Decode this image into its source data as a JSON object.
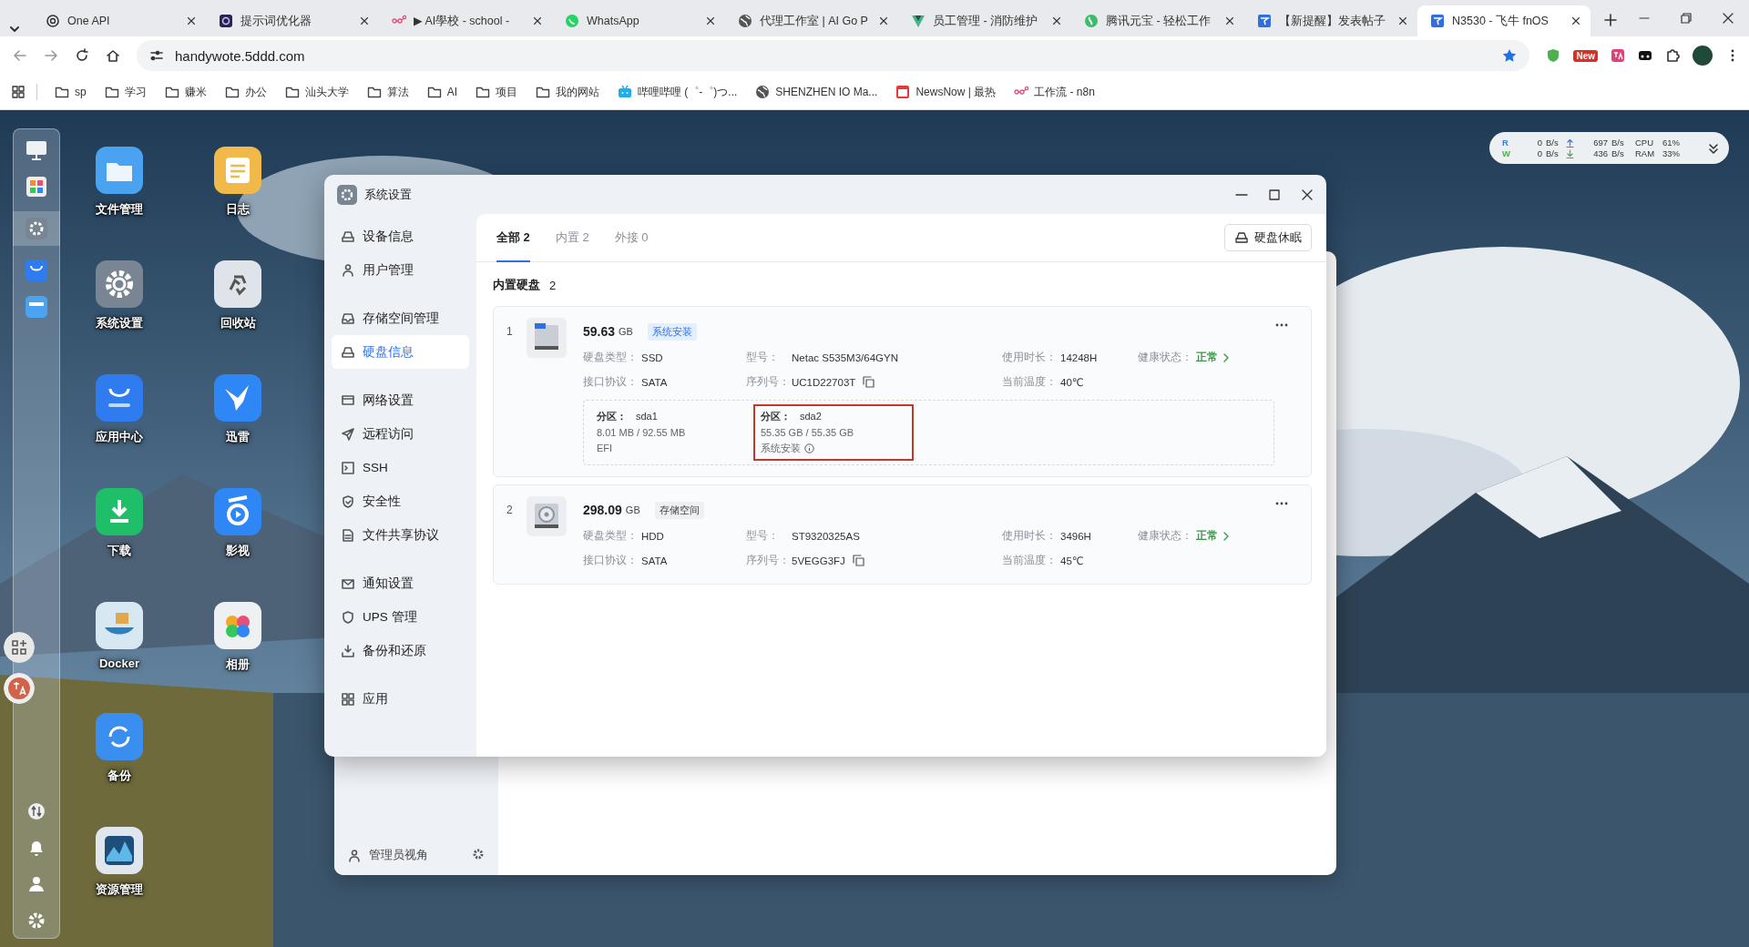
{
  "browser": {
    "tabs": [
      {
        "title": "One API",
        "selected": false
      },
      {
        "title": "提示词优化器",
        "selected": false
      },
      {
        "title": "▶ AI學校 - school -",
        "selected": false
      },
      {
        "title": "WhatsApp",
        "selected": false
      },
      {
        "title": "代理工作室 | AI Go P",
        "selected": false
      },
      {
        "title": "员工管理 - 消防维护",
        "selected": false
      },
      {
        "title": "腾讯元宝 - 轻松工作",
        "selected": false
      },
      {
        "title": "【新提醒】发表帖子",
        "selected": false
      },
      {
        "title": "N3530 - 飞牛 fnOS",
        "selected": true
      }
    ],
    "url": "handywote.5ddd.com",
    "extension_badge": "New",
    "bookmarks": [
      "sp",
      "学习",
      "赚米",
      "办公",
      "汕头大学",
      "算法",
      "AI",
      "项目",
      "我的网站",
      "哔哩哔哩 (゜-゜)つ...",
      "SHENZHEN IO Ma...",
      "NewsNow | 最热",
      "工作流 - n8n"
    ]
  },
  "desktop": {
    "columns": [
      [
        "文件管理",
        "系统设置",
        "应用中心",
        "下载",
        "Docker",
        "备份",
        "资源管理"
      ],
      [
        "日志",
        "回收站",
        "迅雷",
        "影视",
        "相册"
      ]
    ]
  },
  "monitor": {
    "rows": [
      {
        "label": "R",
        "disk": "0",
        "disk_unit": "B/s",
        "net": "697",
        "net_unit": "B/s",
        "metric": "CPU",
        "value": "61%"
      },
      {
        "label": "W",
        "disk": "0",
        "disk_unit": "B/s",
        "net": "436",
        "net_unit": "B/s",
        "metric": "RAM",
        "value": "33%"
      }
    ]
  },
  "back_window": {
    "footer": "管理员视角"
  },
  "settings": {
    "title": "系统设置",
    "sidebar": {
      "groups": [
        {
          "items": [
            {
              "label": "设备信息",
              "selected": false
            },
            {
              "label": "用户管理",
              "selected": false
            }
          ]
        },
        {
          "items": [
            {
              "label": "存储空间管理",
              "selected": false
            },
            {
              "label": "硬盘信息",
              "selected": true
            }
          ]
        },
        {
          "items": [
            {
              "label": "网络设置",
              "selected": false
            },
            {
              "label": "远程访问",
              "selected": false
            },
            {
              "label": "SSH",
              "selected": false
            },
            {
              "label": "安全性",
              "selected": false
            },
            {
              "label": "文件共享协议",
              "selected": false
            }
          ]
        },
        {
          "items": [
            {
              "label": "通知设置",
              "selected": false
            },
            {
              "label": "UPS 管理",
              "selected": false
            },
            {
              "label": "备份和还原",
              "selected": false
            }
          ]
        },
        {
          "items": [
            {
              "label": "应用",
              "selected": false
            }
          ]
        }
      ]
    },
    "tabs": [
      {
        "label": "全部 2",
        "selected": true
      },
      {
        "label": "内置 2",
        "selected": false
      },
      {
        "label": "外接 0",
        "selected": false
      }
    ],
    "sleep_button": "硬盘休眠",
    "section": {
      "title": "内置硬盘",
      "count": "2"
    },
    "disks": [
      {
        "index": "1",
        "kind": "ssd",
        "size": "59.63",
        "unit": "GB",
        "tag": "系统安装",
        "tag_highlighted": true,
        "specs": [
          {
            "label": "硬盘类型：",
            "value": "SSD"
          },
          {
            "label": "型号：",
            "value": "Netac S535M3/64GYN"
          },
          {
            "label": "使用时长：",
            "value": "14248H"
          },
          {
            "label": "健康状态：",
            "value": "正常",
            "kind": "health"
          },
          {
            "label": "接口协议：",
            "value": "SATA"
          },
          {
            "label": "序列号：",
            "value": "UC1D22703T",
            "kind": "copy"
          },
          {
            "label": "当前温度：",
            "value": "40℃"
          }
        ],
        "partitions": [
          {
            "label": "分区：",
            "name": "sda1",
            "usage": "8.01 MB / 92.55 MB",
            "note": "EFI",
            "info": false,
            "highlighted": false
          },
          {
            "label": "分区：",
            "name": "sda2",
            "usage": "55.35 GB / 55.35 GB",
            "note": "系统安装",
            "info": true,
            "highlighted": true
          }
        ]
      },
      {
        "index": "2",
        "kind": "hdd",
        "size": "298.09",
        "unit": "GB",
        "tag": "存储空间",
        "tag_highlighted": false,
        "specs": [
          {
            "label": "硬盘类型：",
            "value": "HDD"
          },
          {
            "label": "型号：",
            "value": "ST9320325AS"
          },
          {
            "label": "使用时长：",
            "value": "3496H"
          },
          {
            "label": "健康状态：",
            "value": "正常",
            "kind": "health"
          },
          {
            "label": "接口协议：",
            "value": "SATA"
          },
          {
            "label": "序列号：",
            "value": "5VEGG3FJ",
            "kind": "copy"
          },
          {
            "label": "当前温度：",
            "value": "45℃"
          }
        ]
      }
    ]
  }
}
